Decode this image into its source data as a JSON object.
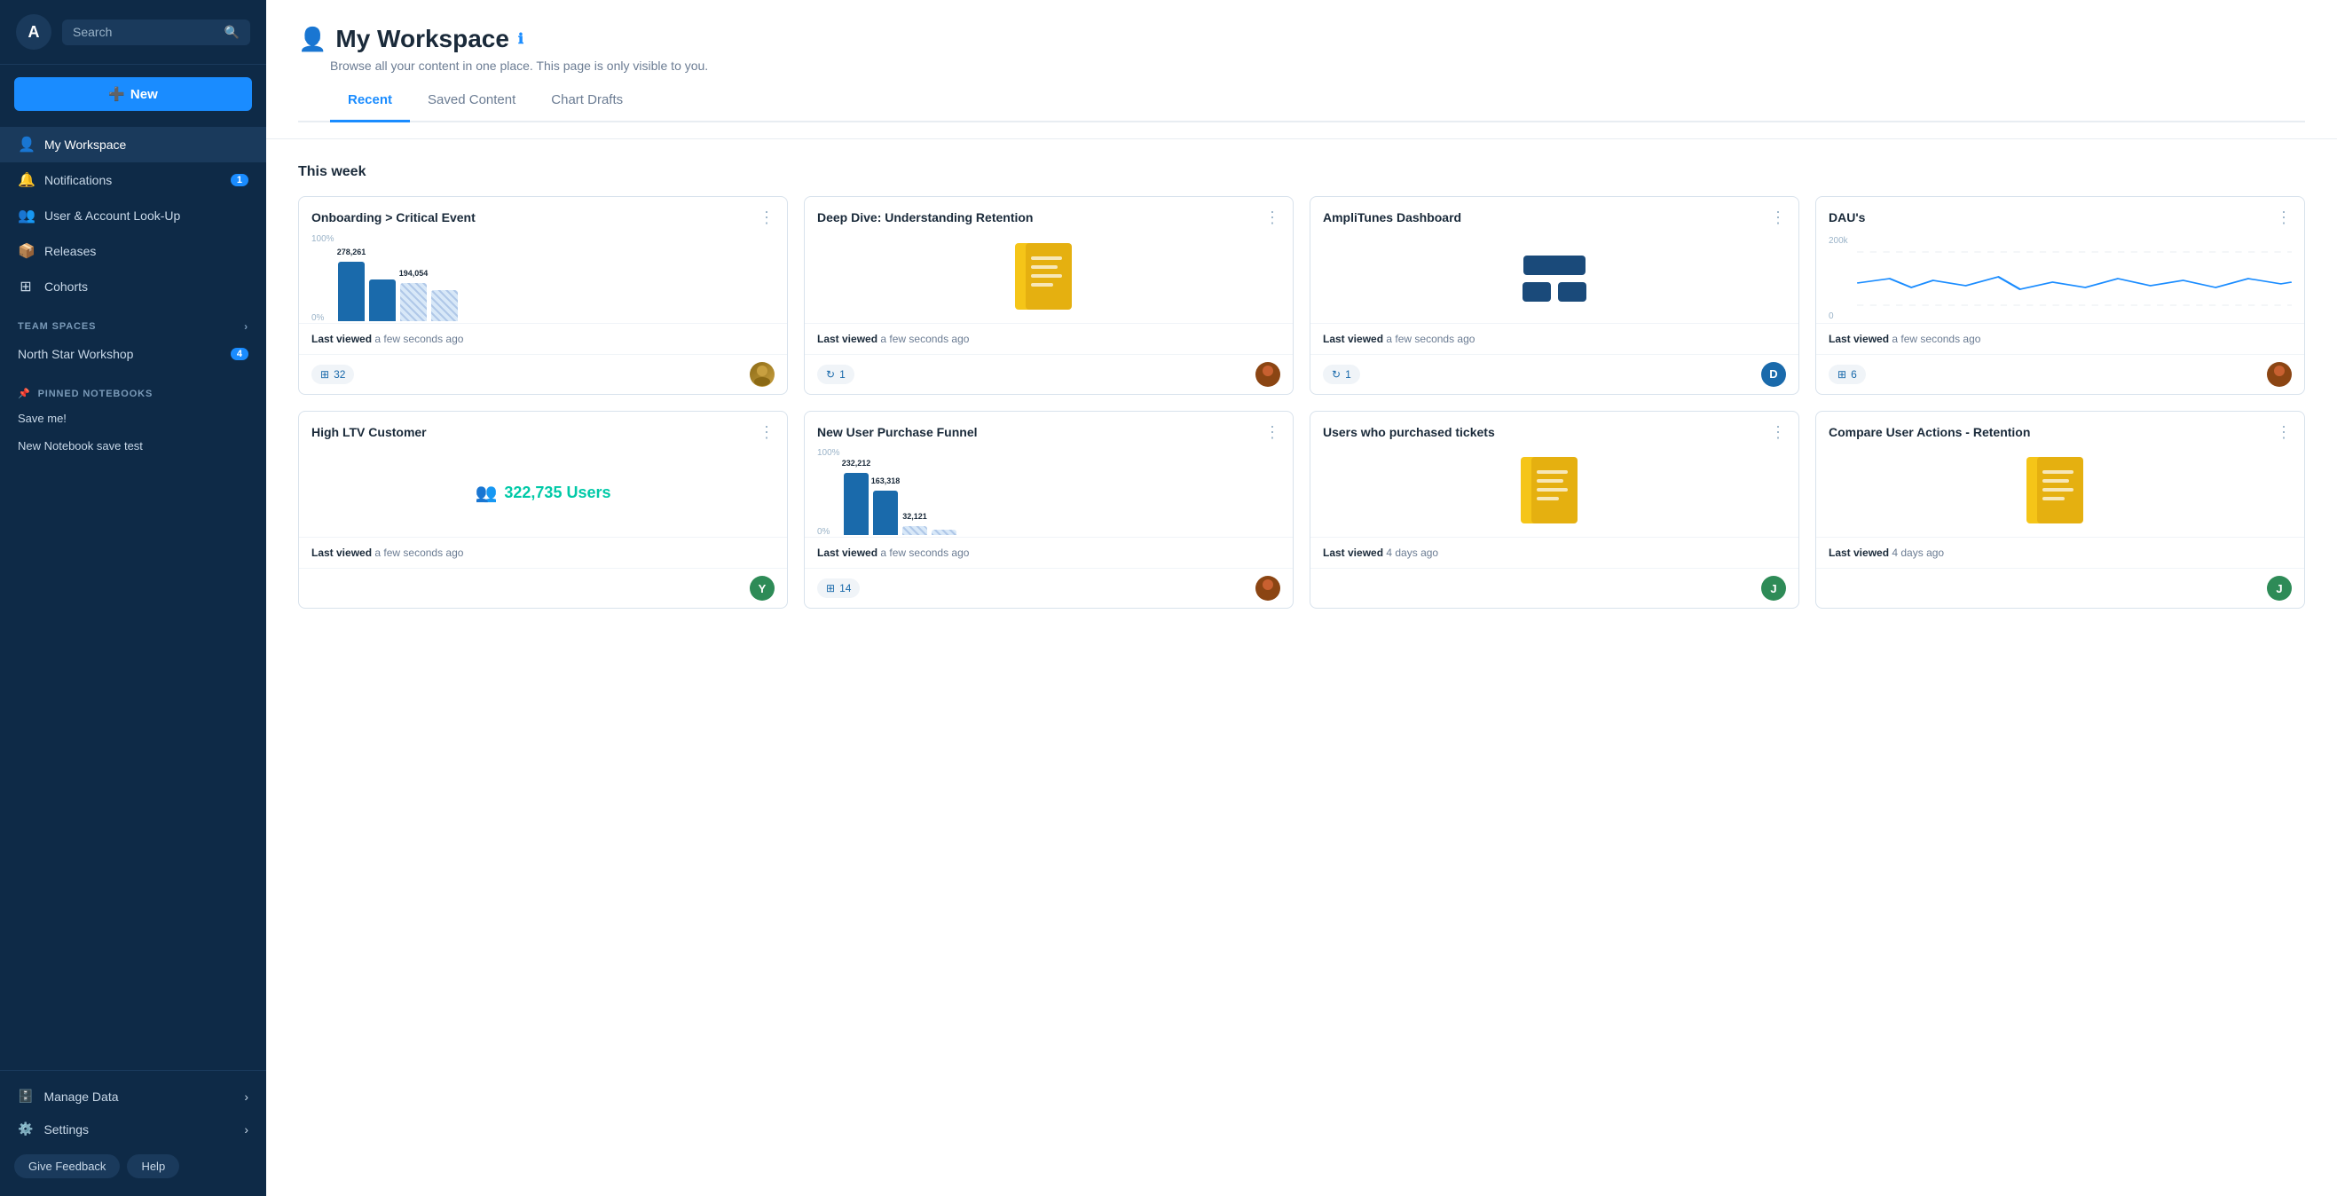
{
  "sidebar": {
    "logo": "A",
    "search_placeholder": "Search",
    "new_label": "New",
    "nav_items": [
      {
        "id": "my-workspace",
        "label": "My Workspace",
        "icon": "person",
        "active": true,
        "badge": null
      },
      {
        "id": "notifications",
        "label": "Notifications",
        "icon": "bell",
        "active": false,
        "badge": "1"
      },
      {
        "id": "user-account",
        "label": "User & Account Look-Up",
        "icon": "people",
        "active": false,
        "badge": null
      },
      {
        "id": "releases",
        "label": "Releases",
        "icon": "box",
        "active": false,
        "badge": null
      },
      {
        "id": "cohorts",
        "label": "Cohorts",
        "icon": "grid",
        "active": false,
        "badge": null
      }
    ],
    "team_spaces_label": "TEAM SPACES",
    "team_items": [
      {
        "id": "north-star",
        "label": "North Star Workshop",
        "badge": "4"
      }
    ],
    "pinned_label": "PINNED NOTEBOOKS",
    "pinned_items": [
      {
        "id": "save-me",
        "label": "Save me!"
      },
      {
        "id": "new-notebook",
        "label": "New Notebook save test"
      }
    ],
    "bottom_items": [
      {
        "id": "manage-data",
        "label": "Manage Data",
        "icon": "database",
        "arrow": true
      },
      {
        "id": "settings",
        "label": "Settings",
        "icon": "gear",
        "arrow": true
      }
    ],
    "feedback_label": "Give Feedback",
    "help_label": "Help"
  },
  "main": {
    "title": "My Workspace",
    "subtitle": "Browse all your content in one place. This page is only visible to you.",
    "tabs": [
      {
        "id": "recent",
        "label": "Recent",
        "active": true
      },
      {
        "id": "saved-content",
        "label": "Saved Content",
        "active": false
      },
      {
        "id": "chart-drafts",
        "label": "Chart Drafts",
        "active": false
      }
    ],
    "section_this_week": "This week",
    "cards_row1": [
      {
        "id": "onboarding",
        "title": "Onboarding > Critical Event",
        "chart_type": "bar",
        "chart_data": {
          "bars": [
            {
              "val": 278261,
              "pct": 85,
              "color": "#1a6aab",
              "label": "278,261"
            },
            {
              "val": 194054,
              "pct": 60,
              "color": "#1a6aab",
              "label": "194,054"
            },
            {
              "val": 0,
              "pct": 55,
              "color": "#b0c8e8",
              "striped": true
            },
            {
              "val": 0,
              "pct": 45,
              "color": "#b0c8e8",
              "striped": true
            }
          ],
          "y_top": "100%",
          "y_bottom": "0%"
        },
        "last_viewed": "Last viewed",
        "last_viewed_time": "a few seconds ago",
        "stat": "32",
        "stat_icon": "table",
        "avatar_color": "#8b6914",
        "avatar_text": ""
      },
      {
        "id": "deep-dive",
        "title": "Deep Dive: Understanding Retention",
        "chart_type": "notebook",
        "last_viewed": "Last viewed",
        "last_viewed_time": "a few seconds ago",
        "stat": "1",
        "stat_icon": "sync",
        "avatar_color": "#8b4513",
        "avatar_text": ""
      },
      {
        "id": "amplitunes",
        "title": "AmpliTunes Dashboard",
        "chart_type": "dashboard",
        "last_viewed": "Last viewed",
        "last_viewed_time": "a few seconds ago",
        "stat": "1",
        "stat_icon": "sync",
        "avatar_color": "#1a6aab",
        "avatar_text": "D"
      },
      {
        "id": "daus",
        "title": "DAU's",
        "chart_type": "line",
        "chart_data": {
          "y_top": "200k",
          "y_bottom": "0"
        },
        "last_viewed": "Last viewed",
        "last_viewed_time": "a few seconds ago",
        "stat": "6",
        "stat_icon": "table",
        "avatar_color": "#8b4513",
        "avatar_text": ""
      }
    ],
    "cards_row2": [
      {
        "id": "high-ltv",
        "title": "High LTV Customer",
        "chart_type": "users",
        "chart_data": {
          "count": "322,735 Users"
        },
        "last_viewed": "Last viewed",
        "last_viewed_time": "a few seconds ago",
        "stat": null,
        "avatar_color": "#2e8b57",
        "avatar_text": "Y"
      },
      {
        "id": "new-user-funnel",
        "title": "New User Purchase Funnel",
        "chart_type": "bar2",
        "chart_data": {
          "bars": [
            {
              "val": 232212,
              "pct": 90,
              "color": "#1a6aab",
              "label": "232,212"
            },
            {
              "val": 163318,
              "pct": 65,
              "color": "#1a6aab",
              "label": "163,318"
            },
            {
              "val": 32121,
              "pct": 13,
              "color": "#b0c8e8",
              "striped": true,
              "label": "32,121"
            },
            {
              "val": 0,
              "pct": 10,
              "color": "#b0c8e8",
              "striped": true
            }
          ],
          "y_top": "100%",
          "y_bottom": "0%"
        },
        "last_viewed": "Last viewed",
        "last_viewed_time": "a few seconds ago",
        "stat": "14",
        "stat_icon": "table",
        "avatar_color": "#8b4513",
        "avatar_text": ""
      },
      {
        "id": "users-tickets",
        "title": "Users who purchased tickets",
        "chart_type": "notebook",
        "last_viewed": "Last viewed",
        "last_viewed_time": "4 days ago",
        "stat": null,
        "avatar_color": "#2e8b57",
        "avatar_text": "J"
      },
      {
        "id": "compare-actions",
        "title": "Compare User Actions - Retention",
        "chart_type": "notebook",
        "last_viewed": "Last viewed",
        "last_viewed_time": "4 days ago",
        "stat": null,
        "avatar_color": "#2e8b57",
        "avatar_text": "J"
      }
    ]
  }
}
